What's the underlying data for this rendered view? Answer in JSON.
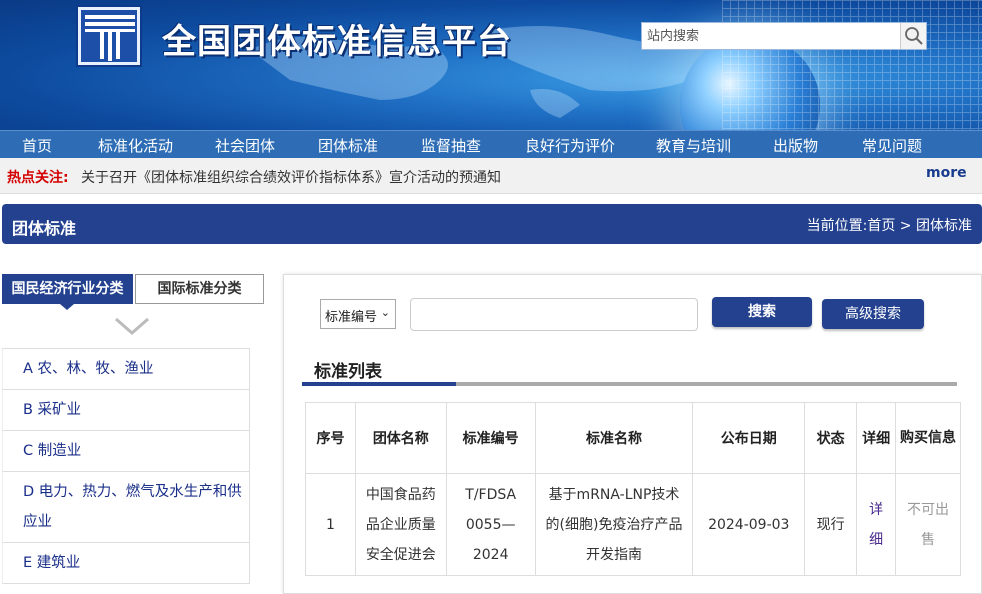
{
  "header": {
    "site_title": "全国团体标准信息平台",
    "search_placeholder": "站内搜索"
  },
  "nav": [
    "首页",
    "标准化活动",
    "社会团体",
    "团体标准",
    "监督抽查",
    "良好行为评价",
    "教育与培训",
    "出版物",
    "常见问题"
  ],
  "hot": {
    "label": "热点关注:",
    "text": "关于召开《团体标准组织综合绩效评价指标体系》宣介活动的预通知",
    "more": "more"
  },
  "section": {
    "title": "团体标准",
    "breadcrumb": "当前位置:首页 > 团体标准"
  },
  "left": {
    "tab_active": "国民经济行业分类",
    "tab_other": "国际标准分类",
    "categories": [
      "A 农、林、牧、渔业",
      "B 采矿业",
      "C 制造业",
      "D 电力、热力、燃气及水生产和供应业",
      "E 建筑业"
    ]
  },
  "search": {
    "select_value": "标准编号",
    "search_btn": "搜索",
    "advanced_btn": "高级搜索"
  },
  "list": {
    "title": "标准列表",
    "headers": [
      "序号",
      "团体名称",
      "标准编号",
      "标准名称",
      "公布日期",
      "状态",
      "详细",
      "购买信息"
    ],
    "rows": [
      {
        "no": "1",
        "org": "中国食品药品企业质量安全促进会",
        "code": "T/FDSA 0055—2024",
        "name": "基于mRNA-LNP技术的(细胞)免疫治疗产品开发指南",
        "date": "2024-09-03",
        "status": "现行",
        "detail": "详细",
        "buy": "不可出售"
      }
    ]
  },
  "colors": {
    "primary": "#23418f",
    "nav": "#2e6db5",
    "hot": "#d40000"
  }
}
